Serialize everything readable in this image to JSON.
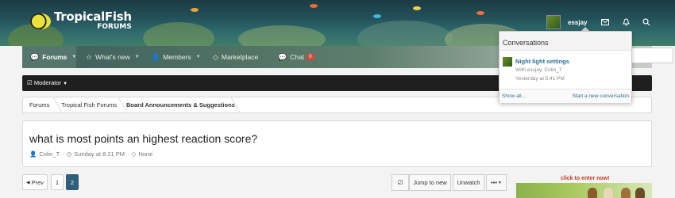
{
  "site": {
    "logo_line1": "TropicalFish",
    "logo_line2": "FORUMS"
  },
  "user": {
    "name": "essjay"
  },
  "nav": {
    "items": [
      {
        "label": "Forums",
        "icon": "chat-bubbles-icon"
      },
      {
        "label": "What's new",
        "icon": "star-icon"
      },
      {
        "label": "Members",
        "icon": "users-icon"
      },
      {
        "label": "Marketplace",
        "icon": "tag-icon"
      },
      {
        "label": "Chat",
        "icon": "chat-icon",
        "badge": "0"
      }
    ]
  },
  "moderator": {
    "label": "Moderator"
  },
  "breadcrumb": [
    "Forums",
    "Tropical Fish Forums",
    "Board Announcements & Suggestions"
  ],
  "thread": {
    "title": "what is most points an highest reaction score?",
    "author": "Colin_T",
    "date": "Sunday at 8:21 PM",
    "tags": "None"
  },
  "pagination": {
    "prev": "Prev",
    "pages": [
      "1",
      "2"
    ],
    "current": "2"
  },
  "toolbar": {
    "jump": "Jump to new",
    "unwatch": "Unwatch",
    "more": "•••"
  },
  "ad": {
    "text": "click to enter now!"
  },
  "conversations": {
    "heading": "Conversations",
    "items": [
      {
        "title": "Night light settings",
        "with": "With essjay, Colin_T",
        "time": "Yesterday at 5:41 PM"
      }
    ],
    "show_all": "Show all...",
    "start_new": "Start a new conversation"
  },
  "colors": {
    "accent": "#2e5f7a",
    "nav": "#3d5f59",
    "badge": "#d24a3c"
  }
}
